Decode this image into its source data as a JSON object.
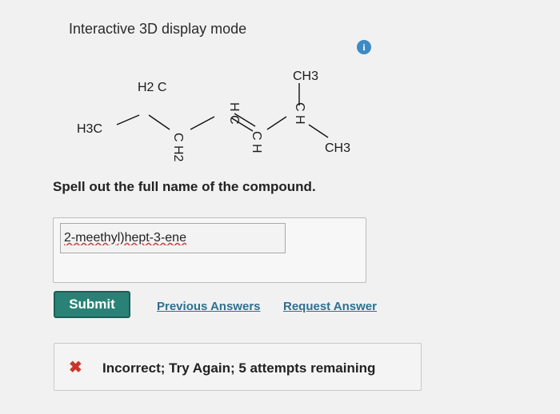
{
  "header": {
    "title": "Interactive 3D display mode",
    "info_icon": "info-icon",
    "info_glyph": "i"
  },
  "molecule": {
    "labels": {
      "h3c_left": "H3C",
      "ch2_top": "H2 C",
      "ch2_bottom": "C H2",
      "ch_upper": "H C",
      "ch_lower": "C H",
      "ch_branch": "C H",
      "ch3_top": "CH3",
      "ch3_right": "CH3"
    }
  },
  "question": {
    "text": "Spell out the full name of the compound."
  },
  "answer": {
    "value": "2-meethyl)hept-3-ene"
  },
  "actions": {
    "submit_label": "Submit",
    "previous_answers": "Previous Answers",
    "request_answer": "Request Answer"
  },
  "feedback": {
    "icon": "x-icon",
    "glyph": "✖",
    "text": "Incorrect; Try Again; 5 attempts remaining",
    "color": "#c8372f"
  }
}
